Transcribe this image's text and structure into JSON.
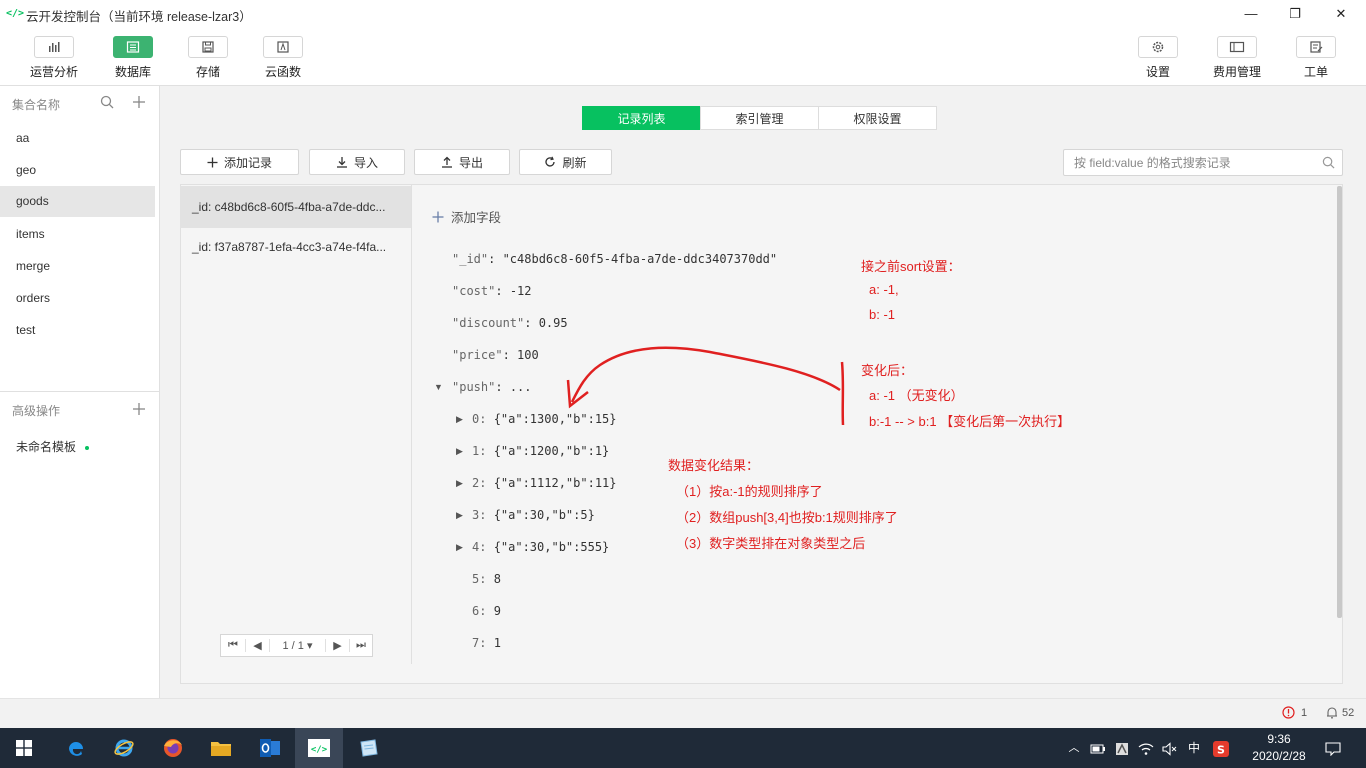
{
  "window": {
    "title": "云开发控制台（当前环境 release-lzar3）",
    "logo": "</>",
    "minimize": "—",
    "maximize": "❐",
    "close": "✕"
  },
  "toolbar": {
    "left": [
      {
        "label": "运营分析",
        "icon": "bar-chart-icon",
        "active": false
      },
      {
        "label": "数据库",
        "icon": "database-icon",
        "active": true
      },
      {
        "label": "存储",
        "icon": "storage-icon",
        "active": false
      },
      {
        "label": "云函数",
        "icon": "function-icon",
        "active": false
      }
    ],
    "right": [
      {
        "label": "设置",
        "icon": "gear-icon"
      },
      {
        "label": "费用管理",
        "icon": "billing-icon"
      },
      {
        "label": "工单",
        "icon": "ticket-icon"
      }
    ]
  },
  "sidebar": {
    "collections_header": "集合名称",
    "collections": [
      "aa",
      "geo",
      "goods",
      "items",
      "merge",
      "orders",
      "test"
    ],
    "selected": "goods",
    "advanced_header": "高级操作",
    "template": "未命名模板"
  },
  "tabs": [
    {
      "label": "记录列表",
      "active": true
    },
    {
      "label": "索引管理",
      "active": false
    },
    {
      "label": "权限设置",
      "active": false
    }
  ],
  "actions": {
    "add_record": "添加记录",
    "import": "导入",
    "export": "导出",
    "refresh": "刷新",
    "search_placeholder": "按 field:value 的格式搜索记录"
  },
  "records": [
    "_id: c48bd6c8-60f5-4fba-a7de-ddc...",
    "_id: f37a8787-1efa-4cc3-a74e-f4fa..."
  ],
  "pager": {
    "first": "⏮",
    "prev": "◀",
    "page": "1 / 1 ▾",
    "next": "▶",
    "last": "⏭"
  },
  "document": {
    "add_field": "添加字段",
    "fields": [
      {
        "key": "\"_id\"",
        "value": "\"c48bd6c8-60f5-4fba-a7de-ddc3407370dd\""
      },
      {
        "key": "\"cost\"",
        "value": "-12"
      },
      {
        "key": "\"discount\"",
        "value": "0.95"
      },
      {
        "key": "\"price\"",
        "value": "100"
      },
      {
        "key": "\"push\"",
        "value": "..."
      }
    ],
    "push_items": [
      {
        "index": "0:",
        "value": "{\"a\":1300,\"b\":15}",
        "expandable": true
      },
      {
        "index": "1:",
        "value": "{\"a\":1200,\"b\":1}",
        "expandable": true
      },
      {
        "index": "2:",
        "value": "{\"a\":1112,\"b\":11}",
        "expandable": true
      },
      {
        "index": "3:",
        "value": "{\"a\":30,\"b\":5}",
        "expandable": true
      },
      {
        "index": "4:",
        "value": "{\"a\":30,\"b\":555}",
        "expandable": true
      },
      {
        "index": "5:",
        "value": "8",
        "expandable": false
      },
      {
        "index": "6:",
        "value": "9",
        "expandable": false
      },
      {
        "index": "7:",
        "value": "1",
        "expandable": false
      }
    ]
  },
  "annotations": {
    "before_title": "接之前sort设置：",
    "before_a": "a: -1,",
    "before_b": "b: -1",
    "after_title": "变化后：",
    "after_a": "a: -1  （无变化）",
    "after_b": "b:-1   -- >  b:1 【变化后第一次执行】",
    "result_title": "数据变化结果：",
    "result_1": "（1）按a:-1的规则排序了",
    "result_2": "（2）数组push[3,4]也按b:1规则排序了",
    "result_3": "（3）数字类型排在对象类型之后",
    "color": "#e02020"
  },
  "statusbar": {
    "errors": "1",
    "notifications": "52"
  },
  "taskbar": {
    "time": "9:36",
    "date": "2020/2/28",
    "ime": "中"
  }
}
